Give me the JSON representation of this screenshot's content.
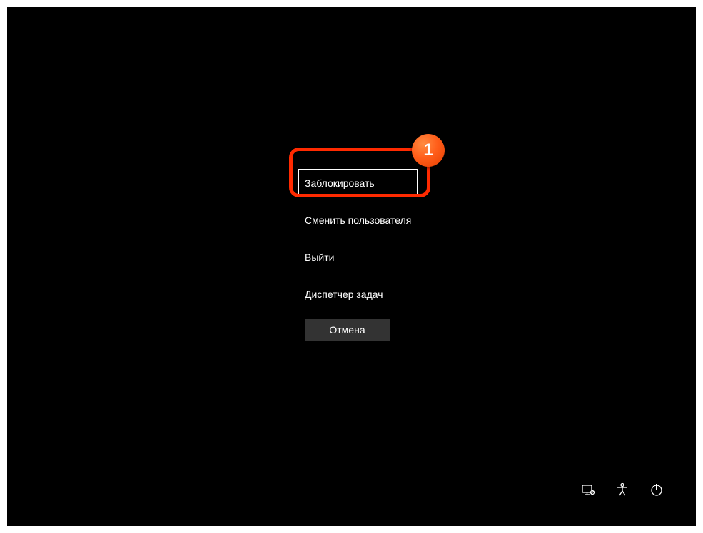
{
  "options": {
    "lock": "Заблокировать",
    "switch_user": "Сменить пользователя",
    "sign_out": "Выйти",
    "task_manager": "Диспетчер задач"
  },
  "cancel_label": "Отмена",
  "callout": {
    "number": "1"
  }
}
